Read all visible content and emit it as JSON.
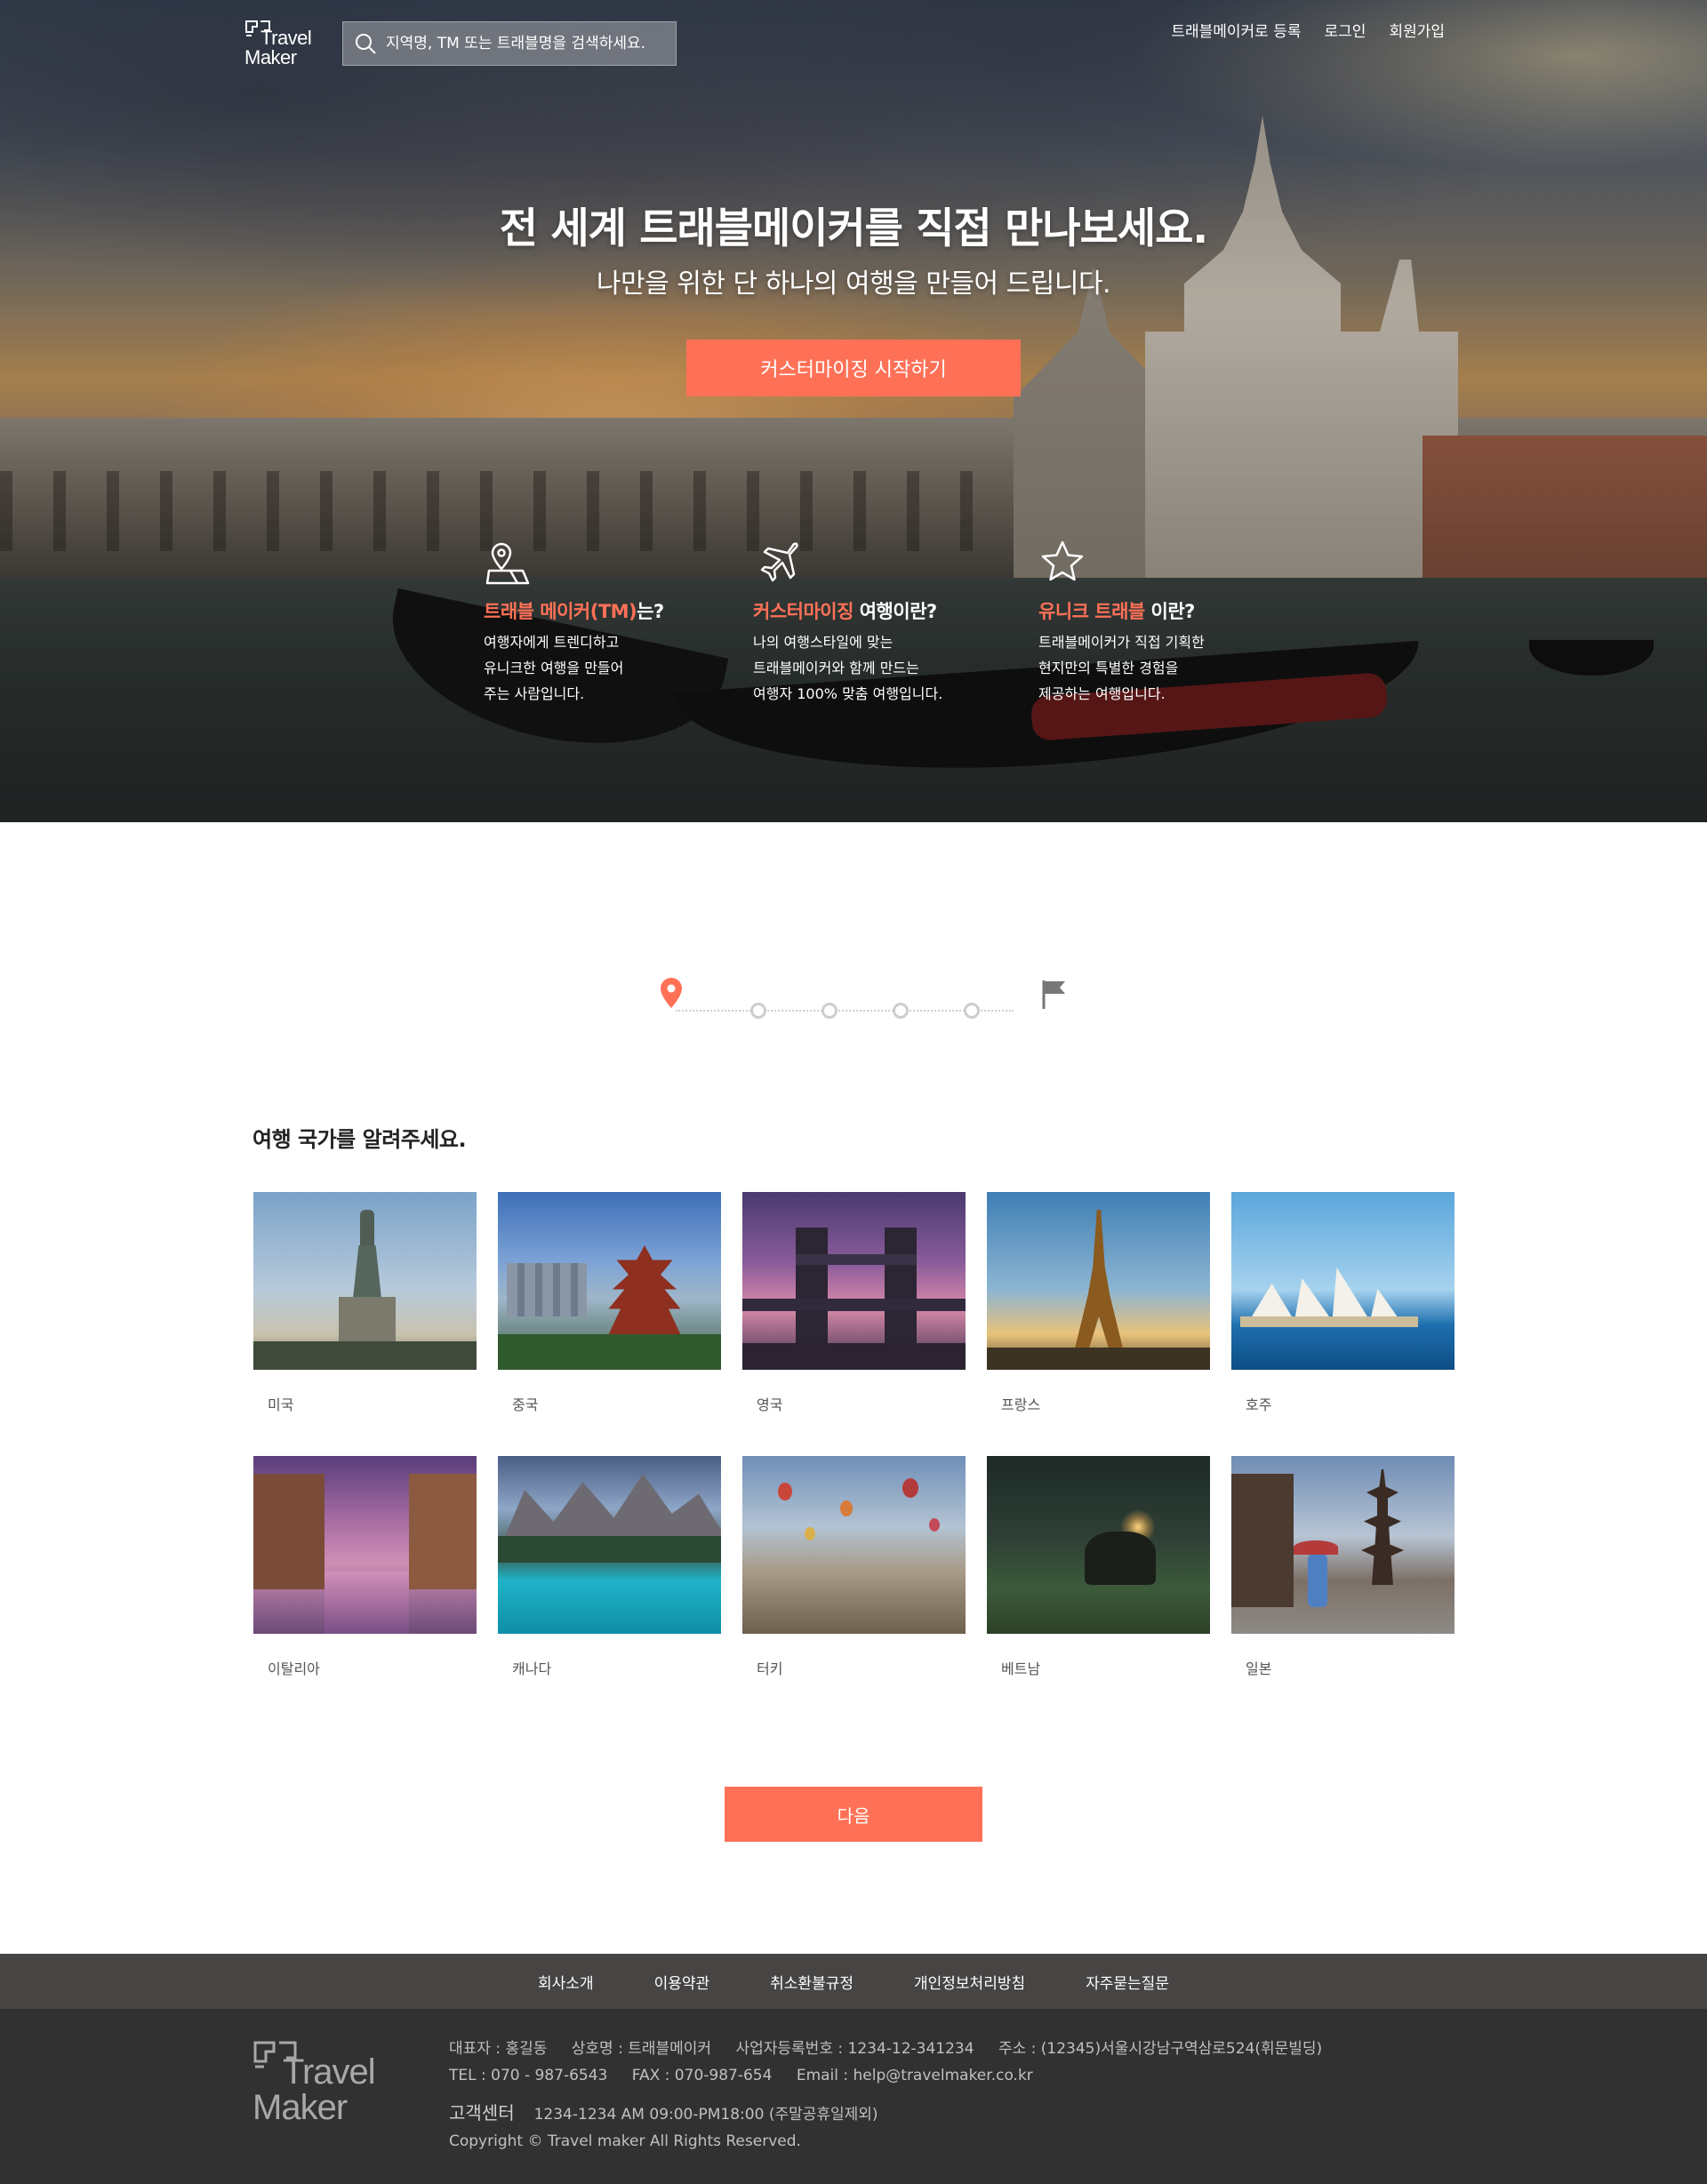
{
  "header": {
    "logo_line1": "Travel",
    "logo_line2": "Maker",
    "search_placeholder": "지역명, TM 또는 트래블명을 검색하세요.",
    "nav": [
      "트래블메이커로 등록",
      "로그인",
      "회원가입"
    ]
  },
  "hero": {
    "title": "전 세계 트래블메이커를 직접 만나보세요.",
    "subtitle": "나만을 위한 단 하나의 여행을 만들어 드립니다.",
    "cta_label": "커스터마이징 시작하기",
    "features": [
      {
        "icon": "map-pin-icon",
        "title_accent": "트래블 메이커(TM)",
        "title_rest": "는?",
        "desc": "여행자에게 트렌디하고\n유니크한 여행을 만들어\n주는 사람입니다."
      },
      {
        "icon": "airplane-icon",
        "title_accent": "커스터마이징",
        "title_rest": " 여행이란?",
        "desc": "나의 여행스타일에 맞는\n트래블메이커와 함께 만드는\n여행자 100% 맞춤 여행입니다."
      },
      {
        "icon": "star-icon",
        "title_accent": "유니크 트래블",
        "title_rest": " 이란?",
        "desc": "트래블메이커가 직접 기획한\n현지만의 특별한 경험을\n제공하는 여행입니다."
      }
    ]
  },
  "stepper": {
    "current_step": 1,
    "total_steps": 6
  },
  "countries": {
    "title": "여행 국가를 알려주세요.",
    "items": [
      {
        "name": "미국"
      },
      {
        "name": "중국"
      },
      {
        "name": "영국"
      },
      {
        "name": "프랑스"
      },
      {
        "name": "호주"
      },
      {
        "name": "이탈리아"
      },
      {
        "name": "캐나다"
      },
      {
        "name": "터키"
      },
      {
        "name": "베트남"
      },
      {
        "name": "일본"
      }
    ],
    "next_label": "다음"
  },
  "footer": {
    "links": [
      "회사소개",
      "이용약관",
      "취소환불규정",
      "개인정보처리방침",
      "자주묻는질문"
    ],
    "logo_line1": "Travel",
    "logo_line2": "Maker",
    "ceo": "대표자 : 홍길동",
    "company": "상호명 : 트래블메이커",
    "biz_no": "사업자등록번호 : 1234-12-341234",
    "address": "주소 : (12345)서울시강남구역삼로524(휘문빌딩)",
    "tel": "TEL : 070 - 987-6543",
    "fax": "FAX : 070-987-654",
    "email": "Email : help@travelmaker.co.kr",
    "cs_label": "고객센터",
    "cs_info": "1234-1234   AM 09:00-PM18:00 (주말공휴일제외)",
    "copyright": "Copyright © Travel maker All Rights Reserved."
  },
  "colors": {
    "accent": "#ff7157",
    "footer_nav_bg": "#474444",
    "footer_bg": "#323131"
  }
}
